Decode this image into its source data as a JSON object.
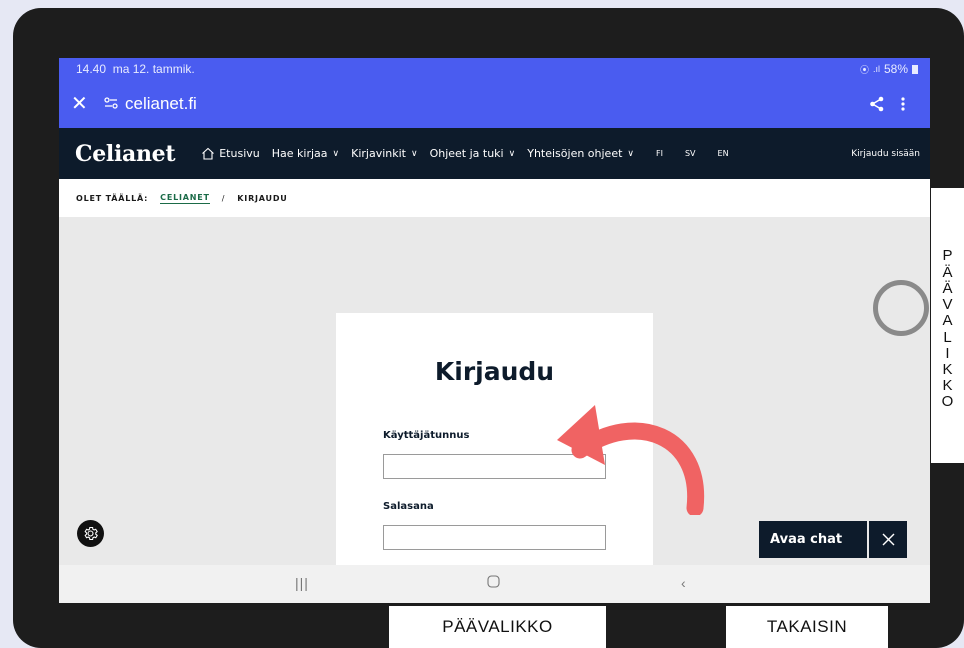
{
  "statusbar": {
    "time": "14.40",
    "date": "ma 12. tammik.",
    "battery": "58%"
  },
  "browser": {
    "domain": "celianet.fi"
  },
  "nav": {
    "logo": "Celianet",
    "home": "Etusivu",
    "items": [
      "Hae kirjaa",
      "Kirjavinkit",
      "Ohjeet ja tuki",
      "Yhteisöjen ohjeet"
    ],
    "langs": [
      "FI",
      "SV",
      "EN"
    ],
    "login": "Kirjaudu sisään"
  },
  "breadcrumb": {
    "prefix": "OLET TÄÄLLÄ:",
    "home": "CELIANET",
    "sep": "/",
    "current": "KIRJAUDU"
  },
  "login": {
    "title": "Kirjaudu",
    "username_label": "Käyttäjätunnus",
    "password_label": "Salasana"
  },
  "chat": {
    "label": "Avaa chat"
  },
  "side_panel": {
    "letters": [
      "P",
      "Ä",
      "Ä",
      "V",
      "A",
      "L",
      "I",
      "K",
      "K",
      "O"
    ]
  },
  "bottom_buttons": {
    "main_menu": "PÄÄVALIKKO",
    "back": "TAKAISIN"
  },
  "colors": {
    "browser_bar": "#4a5cf0",
    "navbar": "#0d1b2b",
    "arrow": "#f06363",
    "link": "#1b6b48"
  }
}
